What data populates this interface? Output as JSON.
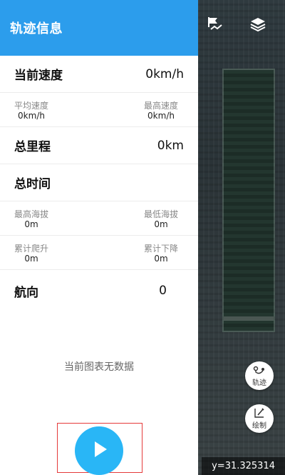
{
  "panel": {
    "title": "轨迹信息",
    "current_speed": {
      "label": "当前速度",
      "value": "0km/h"
    },
    "avg_speed": {
      "label": "平均速度",
      "value": "0km/h"
    },
    "max_speed": {
      "label": "最高速度",
      "value": "0km/h"
    },
    "total_distance": {
      "label": "总里程",
      "value": "0km"
    },
    "total_time": {
      "label": "总时间",
      "value": ""
    },
    "max_altitude": {
      "label": "最高海拔",
      "value": "0m"
    },
    "min_altitude": {
      "label": "最低海拔",
      "value": "0m"
    },
    "total_climb": {
      "label": "累计爬升",
      "value": "0m"
    },
    "total_descent": {
      "label": "累计下降",
      "value": "0m"
    },
    "heading": {
      "label": "航向",
      "value": "0"
    },
    "chart_empty_message": "当前图表无数据"
  },
  "map": {
    "track_button_label": "轨迹",
    "draw_button_label": "绘制",
    "coordinate_readout": "y=31.325314",
    "icons": [
      "route-flag-icon",
      "layers-icon",
      "track-icon",
      "draw-icon"
    ]
  },
  "colors": {
    "header_bg": "#2c9dec",
    "play_button_bg": "#29b6f6",
    "highlight_border": "#e53a3a"
  }
}
